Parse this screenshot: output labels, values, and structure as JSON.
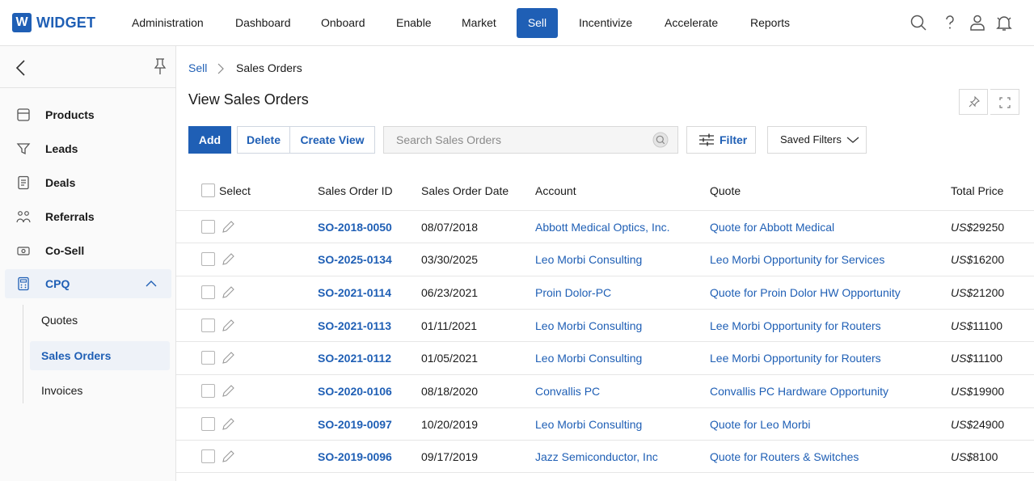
{
  "brand": {
    "logo_letter": "W",
    "name": "WIDGET",
    "color": "#1f5fb5"
  },
  "nav": [
    {
      "label": "Administration"
    },
    {
      "label": "Dashboard"
    },
    {
      "label": "Onboard"
    },
    {
      "label": "Enable"
    },
    {
      "label": "Market"
    },
    {
      "label": "Sell",
      "active": true
    },
    {
      "label": "Incentivize"
    },
    {
      "label": "Accelerate"
    },
    {
      "label": "Reports"
    }
  ],
  "top_icons": [
    "search-icon",
    "help-icon",
    "user-icon",
    "notification-bell-icon"
  ],
  "sidebar": {
    "items": [
      {
        "label": "Products",
        "icon": "products-icon"
      },
      {
        "label": "Leads",
        "icon": "funnel-icon"
      },
      {
        "label": "Deals",
        "icon": "document-icon"
      },
      {
        "label": "Referrals",
        "icon": "referrals-icon"
      },
      {
        "label": "Co-Sell",
        "icon": "handshake-icon"
      },
      {
        "label": "CPQ",
        "icon": "calculator-icon",
        "expanded": true
      }
    ],
    "sub_items": [
      {
        "label": "Quotes"
      },
      {
        "label": "Sales Orders",
        "active": true
      },
      {
        "label": "Invoices"
      }
    ]
  },
  "breadcrumb": {
    "parent": "Sell",
    "current": "Sales Orders"
  },
  "page": {
    "title": "View Sales Orders"
  },
  "toolbar": {
    "add_label": "Add",
    "delete_label": "Delete",
    "create_view_label": "Create View",
    "search_placeholder": "Search Sales Orders",
    "filter_label": "Filter",
    "saved_filters_label": "Saved Filters"
  },
  "table": {
    "headers": {
      "select": "Select",
      "id": "Sales Order ID",
      "date": "Sales Order Date",
      "account": "Account",
      "quote": "Quote",
      "price": "Total Price"
    },
    "rows": [
      {
        "id": "SO-2018-0050",
        "date": "08/07/2018",
        "account": "Abbott Medical Optics, Inc.",
        "quote": "Quote for Abbott Medical",
        "currency": "US$",
        "price": "29250"
      },
      {
        "id": "SO-2025-0134",
        "date": "03/30/2025",
        "account": "Leo Morbi Consulting",
        "quote": "Leo Morbi Opportunity for Services",
        "currency": "US$",
        "price": "16200"
      },
      {
        "id": "SO-2021-0114",
        "date": "06/23/2021",
        "account": "Proin Dolor-PC",
        "quote": "Quote for Proin Dolor HW Opportunity",
        "currency": "US$",
        "price": "21200"
      },
      {
        "id": "SO-2021-0113",
        "date": "01/11/2021",
        "account": "Leo Morbi Consulting",
        "quote": "Lee Morbi Opportunity for Routers",
        "currency": "US$",
        "price": "11100"
      },
      {
        "id": "SO-2021-0112",
        "date": "01/05/2021",
        "account": "Leo Morbi Consulting",
        "quote": "Lee Morbi Opportunity for Routers",
        "currency": "US$",
        "price": "11100"
      },
      {
        "id": "SO-2020-0106",
        "date": "08/18/2020",
        "account": "Convallis PC",
        "quote": "Convallis PC Hardware Opportunity",
        "currency": "US$",
        "price": "19900"
      },
      {
        "id": "SO-2019-0097",
        "date": "10/20/2019",
        "account": "Leo Morbi Consulting",
        "quote": "Quote for Leo Morbi",
        "currency": "US$",
        "price": "24900"
      },
      {
        "id": "SO-2019-0096",
        "date": "09/17/2019",
        "account": "Jazz Semiconductor, Inc",
        "quote": "Quote for Routers & Switches",
        "currency": "US$",
        "price": "8100"
      }
    ]
  }
}
